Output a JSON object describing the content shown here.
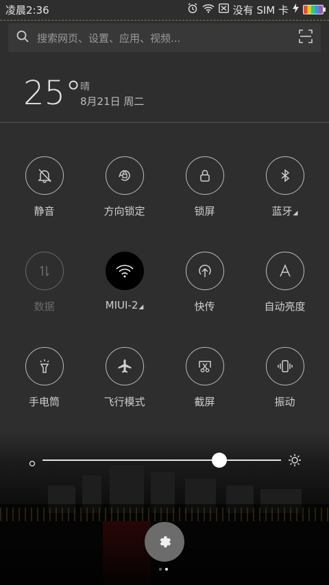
{
  "status_bar": {
    "time": "凌晨2:36",
    "carrier": "没有 SIM 卡",
    "icons": [
      "alarm-icon",
      "wifi-icon",
      "no-sim-icon",
      "charging-icon",
      "battery-icon"
    ]
  },
  "search": {
    "placeholder": "搜索网页、设置、应用、视频..."
  },
  "weather": {
    "temperature": "25°",
    "condition": "晴",
    "date": "8月21日 周二"
  },
  "toggles": [
    {
      "label": "静音",
      "icon": "bell-off-icon",
      "state": "off"
    },
    {
      "label": "方向锁定",
      "icon": "rotation-lock-icon",
      "state": "off"
    },
    {
      "label": "锁屏",
      "icon": "lock-icon",
      "state": "off"
    },
    {
      "label": "蓝牙",
      "icon": "bluetooth-icon",
      "state": "off",
      "has_submenu": true
    },
    {
      "label": "数据",
      "icon": "mobile-data-icon",
      "state": "disabled"
    },
    {
      "label": "MIUI-2",
      "icon": "wifi-icon",
      "state": "on",
      "has_submenu": true
    },
    {
      "label": "快传",
      "icon": "upload-icon",
      "state": "off"
    },
    {
      "label": "自动亮度",
      "icon": "auto-brightness-icon",
      "state": "off"
    },
    {
      "label": "手电筒",
      "icon": "flashlight-icon",
      "state": "off"
    },
    {
      "label": "飞行模式",
      "icon": "airplane-icon",
      "state": "off"
    },
    {
      "label": "截屏",
      "icon": "screenshot-icon",
      "state": "off"
    },
    {
      "label": "振动",
      "icon": "vibrate-icon",
      "state": "off"
    }
  ],
  "brightness": {
    "level": 0.74
  },
  "pager": {
    "pages": 2,
    "current": 2
  },
  "colors": {
    "active_toggle": "#000000",
    "panel_bg": "#2e2e2e",
    "text": "#cfcfcf"
  }
}
